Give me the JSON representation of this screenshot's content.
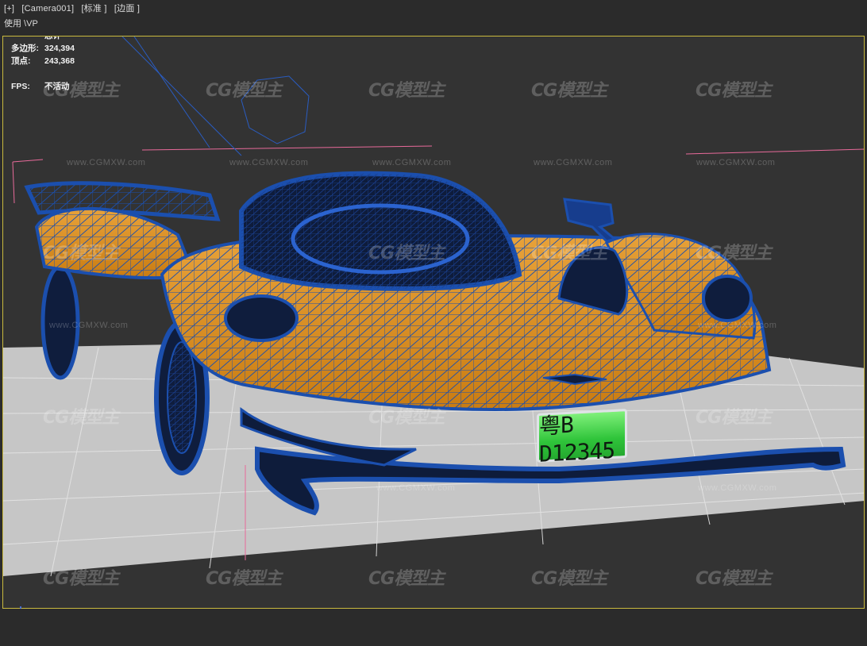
{
  "menu": {
    "plus": "[+]",
    "camera": "[Camera001]",
    "shading": "[标准 ]",
    "mode": "[边面 ]"
  },
  "viewport_label": "使用 \\VP",
  "stats": {
    "header": "总计",
    "polygons_label": "多边形:",
    "polygons_value": "324,394",
    "vertices_label": "顶点:",
    "vertices_value": "243,368",
    "fps_label": "FPS:",
    "fps_value": "不活动"
  },
  "watermark": {
    "logo_text": "CG模型主",
    "url_text": "www.CGMXW.com"
  },
  "license_plate": "粤B D12345",
  "colors": {
    "viewport_border": "#c9b93e",
    "wire": "#1b4fae",
    "body": "#e0961f",
    "plate": "#34c63f",
    "ground": "#c7c7c7"
  }
}
